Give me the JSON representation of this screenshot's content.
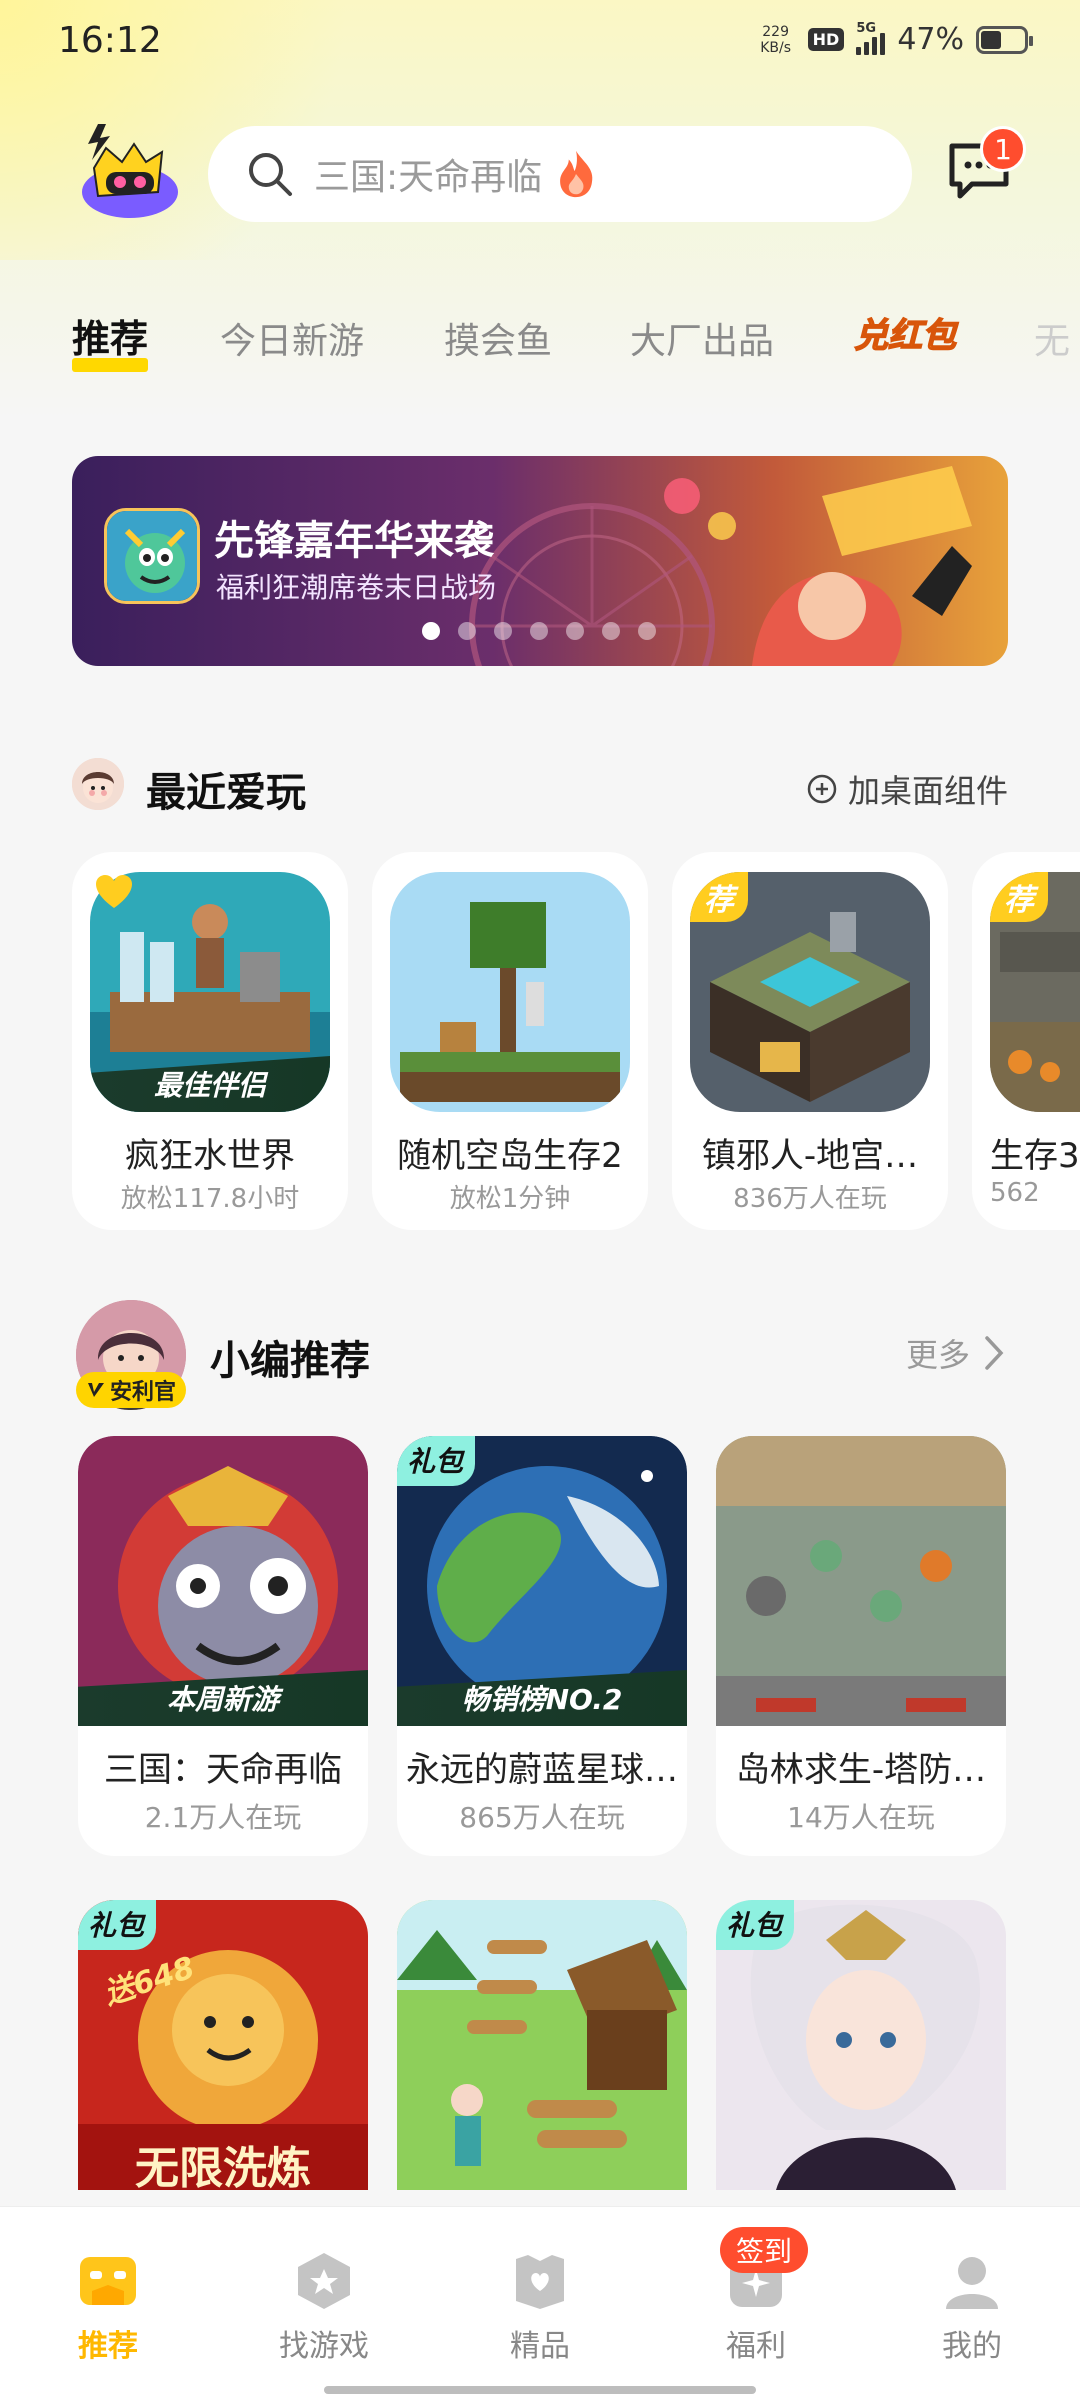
{
  "status_bar": {
    "time": "16:12",
    "net_speed_value": "229",
    "net_speed_unit": "KB/s",
    "hd": "HD",
    "network": "5G",
    "battery_percent": "47%",
    "battery_level": 0.47
  },
  "header": {
    "search_placeholder": "三国:天命再临",
    "message_badge": "1"
  },
  "tabs": [
    "推荐",
    "今日新游",
    "摸会鱼",
    "大厂出品",
    "兑红包",
    "无"
  ],
  "banner": {
    "title": "先锋嘉年华来袭",
    "subtitle": "福利狂潮席卷末日战场",
    "slides": 7,
    "active_slide": 0
  },
  "recent_section": {
    "title": "最近爱玩",
    "action": "加桌面组件",
    "games": [
      {
        "name": "疯狂水世界",
        "sub": "放松117.8小时",
        "ribbon": "最佳伴侣",
        "tag": "heart"
      },
      {
        "name": "随机空岛生存2",
        "sub": "放松1分钟",
        "tag": ""
      },
      {
        "name": "镇邪人-地宫…",
        "sub": "836万人在玩",
        "tag": "荐"
      },
      {
        "name": "生存3",
        "sub": "562",
        "tag": "荐"
      }
    ]
  },
  "editor_section": {
    "title": "小编推荐",
    "badge": "安利官",
    "more": "更多",
    "games": [
      {
        "name": "三国：天命再临",
        "sub": "2.1万人在玩",
        "ribbon": "本周新游",
        "tag": ""
      },
      {
        "name": "永远的蔚蓝星球…",
        "sub": "865万人在玩",
        "ribbon": "畅销榜NO.2",
        "tag": "礼包"
      },
      {
        "name": "岛林求生-塔防…",
        "sub": "14万人在玩",
        "tag": ""
      }
    ],
    "row2": [
      {
        "tag": "礼包",
        "art_text": "无限洗炼",
        "art_text2": "送648"
      },
      {
        "tag": ""
      },
      {
        "tag": "礼包"
      }
    ]
  },
  "bottom_nav": {
    "items": [
      "推荐",
      "找游戏",
      "精品",
      "福利",
      "我的"
    ],
    "active": 0,
    "sign_badge": "签到"
  },
  "colors": {
    "accent": "#ffd800",
    "active_nav": "#ffb800",
    "badge_red": "#ff4d2e",
    "gift_tag": "#8ef0e0"
  }
}
